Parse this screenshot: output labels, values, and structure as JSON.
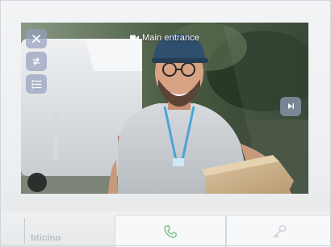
{
  "screen": {
    "camera_label": "Main entrance",
    "camera_icon": "video-camera-icon"
  },
  "sidebar": {
    "buttons": [
      {
        "icon": "close-icon"
      },
      {
        "icon": "swap-icon"
      },
      {
        "icon": "list-icon"
      }
    ]
  },
  "right_control": {
    "icon": "next-icon"
  },
  "bottom": {
    "brand": "bticino",
    "keys": [
      {
        "icon": "phone-icon",
        "color": "#79c08a"
      },
      {
        "icon": "key-icon",
        "color": "#cdd0d3"
      }
    ]
  },
  "colors": {
    "overlay_button": "#96a0be",
    "device_body": "#eceef0"
  }
}
